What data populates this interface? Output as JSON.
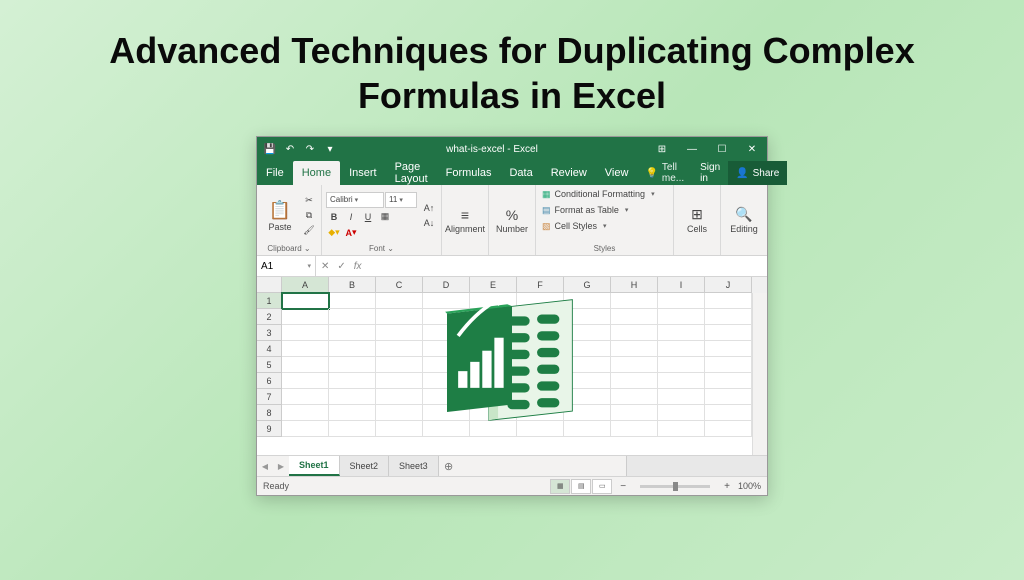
{
  "page": {
    "title": "Advanced Techniques for Duplicating Complex Formulas in Excel"
  },
  "titlebar": {
    "doc_title": "what-is-excel - Excel"
  },
  "menu": {
    "file": "File",
    "home": "Home",
    "insert": "Insert",
    "page_layout": "Page Layout",
    "formulas": "Formulas",
    "data": "Data",
    "review": "Review",
    "view": "View",
    "tell_me": "Tell me...",
    "sign_in": "Sign in",
    "share": "Share"
  },
  "ribbon": {
    "paste": "Paste",
    "clipboard": "Clipboard",
    "font_name": "Calibri",
    "font_size": "11",
    "font": "Font",
    "alignment": "Alignment",
    "number": "Number",
    "cond_fmt": "Conditional Formatting",
    "fmt_table": "Format as Table",
    "cell_styles": "Cell Styles",
    "styles": "Styles",
    "cells": "Cells",
    "editing": "Editing"
  },
  "formula_bar": {
    "name_box": "A1",
    "fx": "fx"
  },
  "columns": [
    "A",
    "B",
    "C",
    "D",
    "E",
    "F",
    "G",
    "H",
    "I",
    "J"
  ],
  "rows": [
    "1",
    "2",
    "3",
    "4",
    "5",
    "6",
    "7",
    "8",
    "9"
  ],
  "active_cell": "A1",
  "sheets": {
    "s1": "Sheet1",
    "s2": "Sheet2",
    "s3": "Sheet3"
  },
  "status": {
    "ready": "Ready",
    "zoom": "100%"
  }
}
